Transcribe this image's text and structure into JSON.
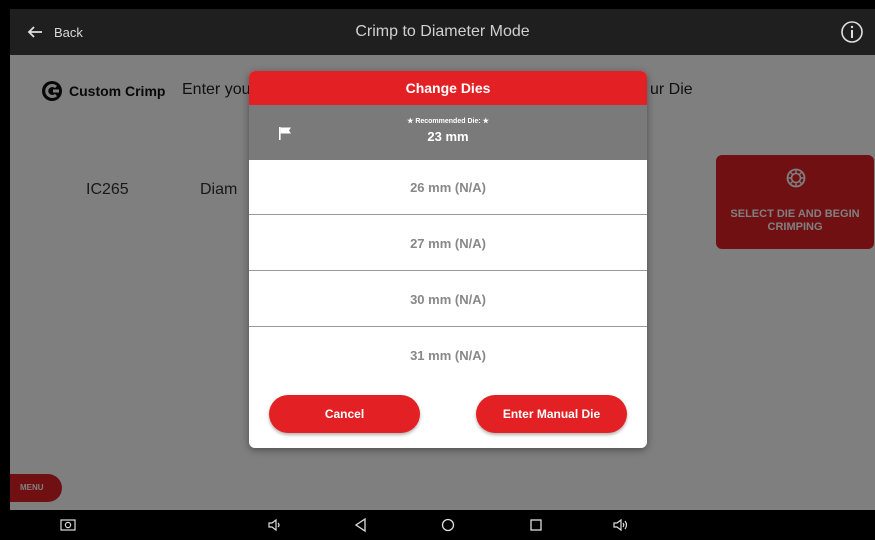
{
  "topbar": {
    "back_label": "Back",
    "title": "Crimp to Diameter Mode"
  },
  "main": {
    "brand": "Custom Crimp",
    "prompt_left": "Enter you",
    "prompt_right": "ur Die",
    "part_number": "IC265",
    "diameter_label": "Diam",
    "select_button_label": "SELECT DIE AND BEGIN CRIMPING",
    "menu_label": "MENU"
  },
  "dialog": {
    "title": "Change Dies",
    "recommended_label": "★ Recommended Die: ★",
    "recommended_value": "23 mm",
    "options": [
      "26 mm (N/A)",
      "27 mm (N/A)",
      "30 mm (N/A)",
      "31 mm (N/A)"
    ],
    "cancel_label": "Cancel",
    "manual_label": "Enter Manual Die"
  },
  "colors": {
    "accent": "#e32124",
    "topbar": "#1f1f1f",
    "selected_row": "#7a7a7a"
  },
  "icons": [
    "back-arrow-icon",
    "info-icon",
    "brand-logo-icon",
    "die-gear-icon",
    "flag-icon",
    "screenshot-icon",
    "volume-down-icon",
    "back-triangle-icon",
    "home-circle-icon",
    "recents-square-icon",
    "volume-up-icon"
  ]
}
